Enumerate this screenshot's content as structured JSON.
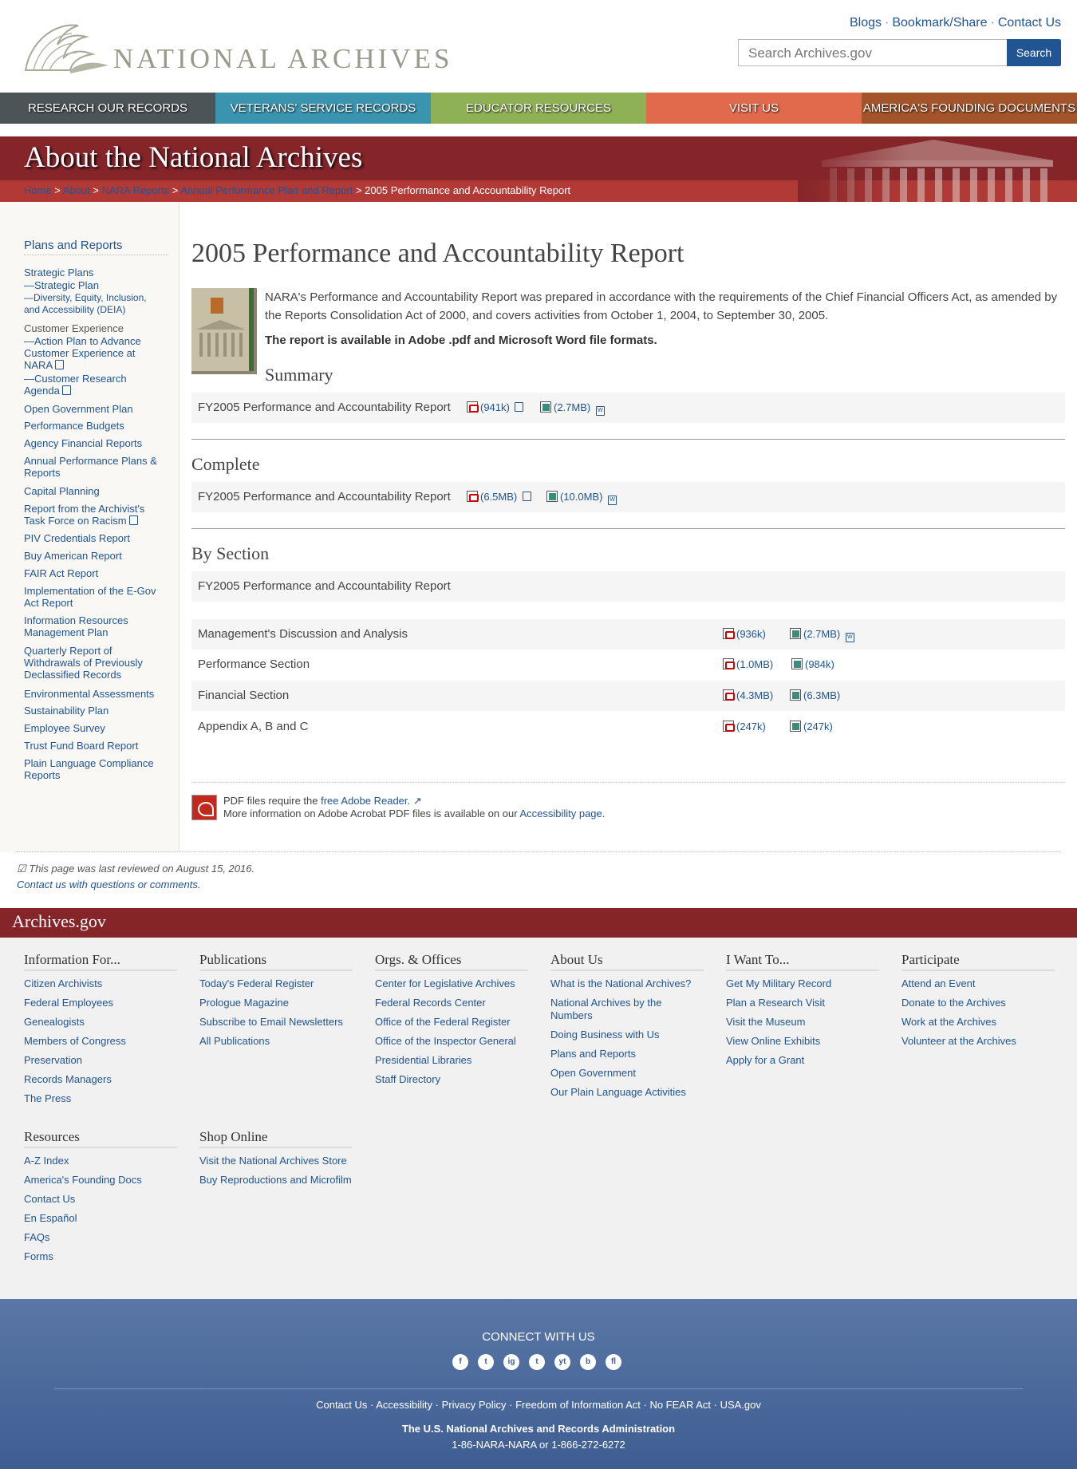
{
  "header": {
    "logo_text": "NATIONAL ARCHIVES",
    "top_links": [
      "Blogs",
      "Bookmark/Share",
      "Contact Us"
    ],
    "search_placeholder": "Search Archives.gov",
    "search_button": "Search"
  },
  "nav": [
    {
      "label": "RESEARCH OUR RECORDS",
      "color": "#4d5458"
    },
    {
      "label": "VETERANS' SERVICE RECORDS",
      "color": "#3a94b0"
    },
    {
      "label": "EDUCATOR RESOURCES",
      "color": "#8fb156"
    },
    {
      "label": "VISIT US",
      "color": "#e16a4c"
    },
    {
      "label": "AMERICA'S FOUNDING DOCUMENTS",
      "color": "#a3542a"
    }
  ],
  "banner": {
    "title": "About the National Archives",
    "breadcrumb": [
      "Home",
      "About",
      "NARA Reports",
      "Annual Performance Plan and Report",
      "2005 Performance and Accountability Report"
    ]
  },
  "sidebar": {
    "title": "Plans and Reports",
    "items": [
      "Strategic Plans",
      "—Strategic Plan",
      "—Diversity, Equity, Inclusion, and Accessibility (DEIA)",
      "Customer Experience",
      "—Action Plan to Advance Customer Experience at NARA",
      "—Customer Research Agenda",
      "Open Government Plan",
      "Performance Budgets",
      "Agency Financial Reports",
      "Annual Performance Plans & Reports",
      "Capital Planning",
      "Report from the Archivist's Task Force on Racism",
      "PIV Credentials Report",
      "Buy American Report",
      "FAIR Act Report",
      "Implementation of the E-Gov Act Report",
      "Information Resources Management Plan",
      "Quarterly Report of Withdrawals of Previously Declassified Records",
      "Environmental Assessments",
      "Sustainability Plan",
      "Employee Survey",
      "Trust Fund Board Report",
      "Plain Language Compliance Reports"
    ]
  },
  "main": {
    "title": "2005 Performance and Accountability Report",
    "intro": "NARA's Performance and Accountability Report was prepared in accordance with the requirements of the Chief Financial Officers Act, as amended by the Reports Consolidation Act of 2000, and covers activities from October 1, 2004, to September 30, 2005.",
    "availability": "The report is available in Adobe .pdf and Microsoft Word file formats.",
    "summary": {
      "heading": "Summary",
      "label": "FY2005 Performance and Accountability Report",
      "pdf": "(941k)",
      "doc": "(2.7MB)"
    },
    "complete": {
      "heading": "Complete",
      "label": "FY2005 Performance and Accountability Report",
      "pdf": "(6.5MB)",
      "doc": "(10.0MB)"
    },
    "by_section": {
      "heading": "By Section",
      "label": "FY2005 Performance and Accountability Report",
      "rows": [
        {
          "label": "Management's Discussion and Analysis",
          "pdf": "(936k)",
          "doc": "(2.7MB)"
        },
        {
          "label": "Performance Section",
          "pdf": "(1.0MB)",
          "doc": "(984k)"
        },
        {
          "label": "Financial Section",
          "pdf": "(4.3MB)",
          "doc": "(6.3MB)"
        },
        {
          "label": "Appendix A, B and C",
          "pdf": "(247k)",
          "doc": "(247k)"
        }
      ]
    },
    "pdf_note_1": "PDF files require the ",
    "pdf_note_link": "free Adobe Reader.",
    "pdf_note_2": "More information on Adobe Acrobat PDF files is available on our ",
    "pdf_note_link2": "Accessibility page.",
    "reviewed": "This page was last reviewed on August 15, 2016.",
    "contact": "Contact us with questions or comments."
  },
  "footer": {
    "site": "Archives.gov",
    "columns": [
      {
        "heading": "Information For...",
        "links": [
          "Citizen Archivists",
          "Federal Employees",
          "Genealogists",
          "Members of Congress",
          "Preservation",
          "Records Managers",
          "The Press"
        ]
      },
      {
        "heading": "Publications",
        "links": [
          "Today's Federal Register",
          "Prologue Magazine",
          "Subscribe to Email Newsletters",
          "All Publications"
        ]
      },
      {
        "heading": "Orgs. & Offices",
        "links": [
          "Center for Legislative Archives",
          "Federal Records Center",
          "Office of the Federal Register",
          "Office of the Inspector General",
          "Presidential Libraries",
          "Staff Directory"
        ]
      },
      {
        "heading": "About Us",
        "links": [
          "What is the National Archives?",
          "National Archives by the Numbers",
          "Doing Business with Us",
          "Plans and Reports",
          "Open Government",
          "Our Plain Language Activities"
        ]
      },
      {
        "heading": "I Want To...",
        "links": [
          "Get My Military Record",
          "Plan a Research Visit",
          "Visit the Museum",
          "View Online Exhibits",
          "Apply for a Grant"
        ]
      },
      {
        "heading": "Participate",
        "links": [
          "Attend an Event",
          "Donate to the Archives",
          "Work at the Archives",
          "Volunteer at the Archives"
        ]
      },
      {
        "heading": "Resources",
        "links": [
          "A-Z Index",
          "America's Founding Docs",
          "Contact Us",
          "En Español",
          "FAQs",
          "Forms"
        ]
      },
      {
        "heading": "Shop Online",
        "links": [
          "Visit the National Archives Store",
          "Buy Reproductions and Microfilm"
        ]
      }
    ],
    "connect": "CONNECT WITH US",
    "social": [
      "f",
      "t",
      "ig",
      "t",
      "yt",
      "b",
      "fl"
    ],
    "bottom_links": [
      "Contact Us",
      "Accessibility",
      "Privacy Policy",
      "Freedom of Information Act",
      "No FEAR Act",
      "USA.gov"
    ],
    "agency": "The U.S. National Archives and Records Administration",
    "phone": "1-86-NARA-NARA or 1-866-272-6272"
  }
}
